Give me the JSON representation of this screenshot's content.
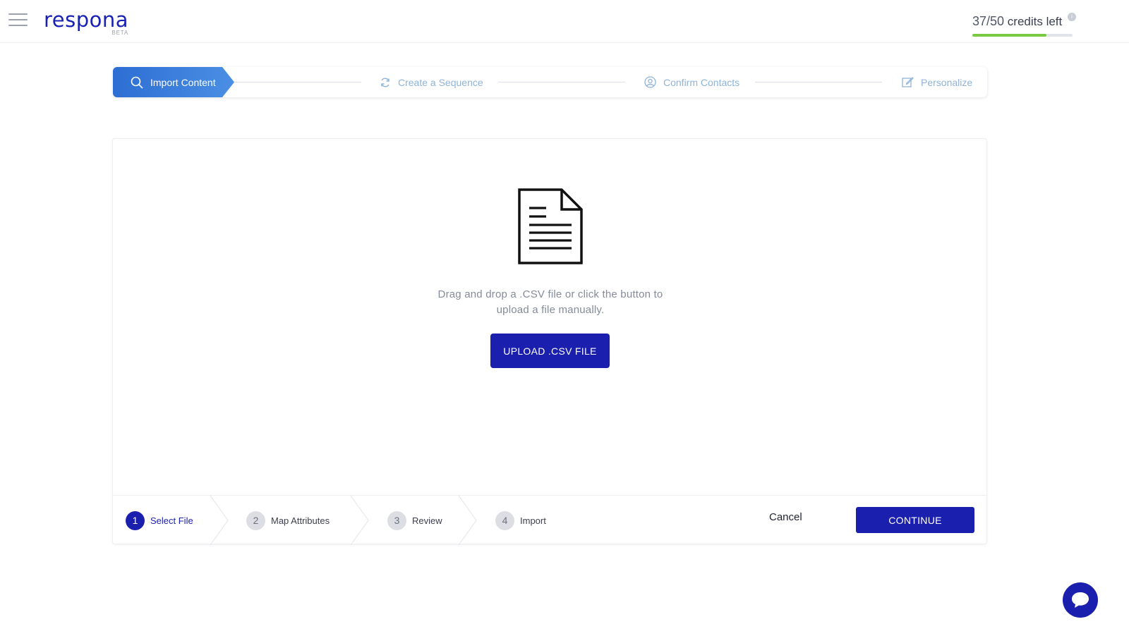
{
  "header": {
    "logo_text": "respona",
    "logo_badge": "BETA",
    "credits_used": "37/50",
    "credits_suffix": "credits left",
    "credits_info": "i",
    "credits_fraction": 0.74,
    "credits_color": "#7ac943"
  },
  "wizard": {
    "steps": [
      {
        "label": "Import Content",
        "icon": "search-icon",
        "active": true
      },
      {
        "label": "Create a Sequence",
        "icon": "refresh-icon",
        "active": false
      },
      {
        "label": "Confirm Contacts",
        "icon": "user-circle-icon",
        "active": false
      },
      {
        "label": "Personalize",
        "icon": "edit-icon",
        "active": false
      }
    ]
  },
  "upload": {
    "icon": "document-icon",
    "instruction": "Drag and drop a .CSV file or click the button to upload a file manually.",
    "button_label": "UPLOAD .CSV FILE"
  },
  "footer": {
    "steps": [
      {
        "number": "1",
        "label": "Select File",
        "active": true
      },
      {
        "number": "2",
        "label": "Map Attributes",
        "active": false
      },
      {
        "number": "3",
        "label": "Review",
        "active": false
      },
      {
        "number": "4",
        "label": "Import",
        "active": false
      }
    ],
    "cancel_label": "Cancel",
    "continue_label": "CONTINUE"
  },
  "colors": {
    "primary": "#1b1fae",
    "active_step": "#2d6ed3"
  },
  "chat": {
    "icon": "chat-bubble-icon"
  }
}
